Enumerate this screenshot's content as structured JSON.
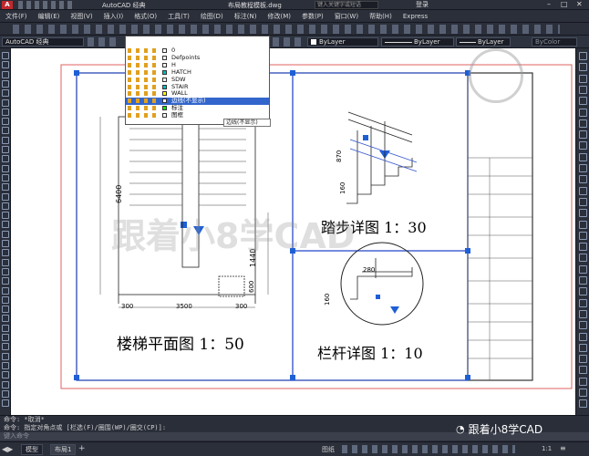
{
  "titlebar": {
    "app": "AutoCAD 经典",
    "doc": "布局教程模板.dwg",
    "search_placeholder": "键入关键字或短语",
    "login": "登录",
    "expr": "Express"
  },
  "menu": [
    "文件(F)",
    "编辑(E)",
    "视图(V)",
    "插入(I)",
    "格式(O)",
    "工具(T)",
    "绘图(D)",
    "标注(N)",
    "修改(M)",
    "参数(P)",
    "窗口(W)",
    "帮助(H)"
  ],
  "workspace": "AutoCAD 经典",
  "layer_current": "标注",
  "layers": [
    {
      "name": "0",
      "color": "#ffffff"
    },
    {
      "name": "Defpoints",
      "color": "#ffffff"
    },
    {
      "name": "H",
      "color": "#ffffff"
    },
    {
      "name": "HATCH",
      "color": "#00c0c0"
    },
    {
      "name": "SDW",
      "color": "#ffffff"
    },
    {
      "name": "STAIR",
      "color": "#00c0c0"
    },
    {
      "name": "WALL",
      "color": "#ffff00"
    },
    {
      "name": "边线(不显示)",
      "color": "#ffffff"
    },
    {
      "name": "标注",
      "color": "#00ff00"
    },
    {
      "name": "图框",
      "color": "#ffffff"
    }
  ],
  "layer_selected_index": 7,
  "tooltip": "边线(不显示)",
  "props": {
    "color": "ByLayer",
    "linetype": "ByLayer",
    "lineweight": "ByLayer",
    "plotstyle": "ByColor"
  },
  "drawing": {
    "plan_title": "楼梯平面图  1：50",
    "tread_title": "踏步详图  1：30",
    "rail_title": "栏杆详图  1：10",
    "dim_6400": "6400",
    "dim_3500": "3500",
    "dim_300a": "300",
    "dim_300b": "300",
    "dim_1440": "1440",
    "dim_600": "600",
    "dim_870": "870",
    "dim_160a": "160",
    "dim_280": "280",
    "dim_160b": "160",
    "watermark": "跟着小8学CAD"
  },
  "command": [
    "命令: *取消*",
    "命令: 指定对角点或 [栏选(F)/圈围(WP)/圈交(CP)]:"
  ],
  "command_placeholder": "键入命令",
  "tabs": [
    "模型",
    "布局1"
  ],
  "status_space": "图纸",
  "status_scale": "1:1",
  "brand": "跟着小8学CAD"
}
